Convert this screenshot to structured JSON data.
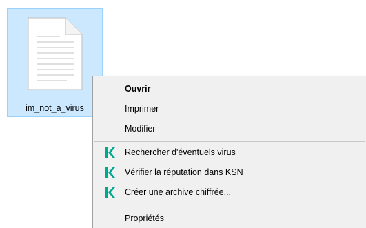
{
  "file": {
    "name": "im_not_a_virus",
    "icon": "text-file-icon"
  },
  "context_menu": {
    "items": [
      {
        "label": "Ouvrir",
        "bold": true
      },
      {
        "label": "Imprimer"
      },
      {
        "label": "Modifier"
      },
      {
        "label": "Rechercher d'éventuels virus",
        "icon": "kaspersky-k-icon"
      },
      {
        "label": "Vérifier la réputation dans KSN",
        "icon": "kaspersky-k-icon"
      },
      {
        "label": "Créer une archive chiffrée...",
        "icon": "kaspersky-k-icon"
      },
      {
        "label": "Propriétés"
      }
    ],
    "accent_color": "#00a88e"
  }
}
